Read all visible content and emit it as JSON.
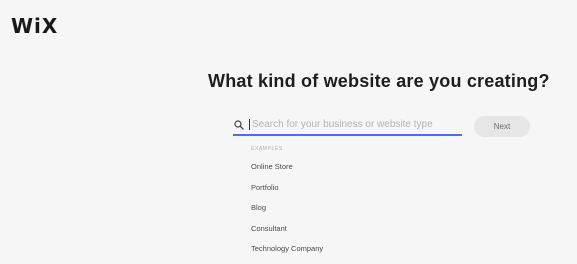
{
  "brand": {
    "logo_text": "WiX"
  },
  "main": {
    "heading": "What kind of website are you creating?"
  },
  "search": {
    "placeholder": "Search for your business or website type",
    "value": "",
    "icon": "search-icon",
    "next_label": "Next"
  },
  "examples": {
    "label": "EXAMPLES",
    "items": [
      {
        "label": "Online Store"
      },
      {
        "label": "Portfolio"
      },
      {
        "label": "Blog"
      },
      {
        "label": "Consultant"
      },
      {
        "label": "Technology Company"
      }
    ]
  },
  "colors": {
    "accent": "#4a6fe8",
    "background": "#f6f6f6",
    "button_bg": "#e6e6e6"
  }
}
